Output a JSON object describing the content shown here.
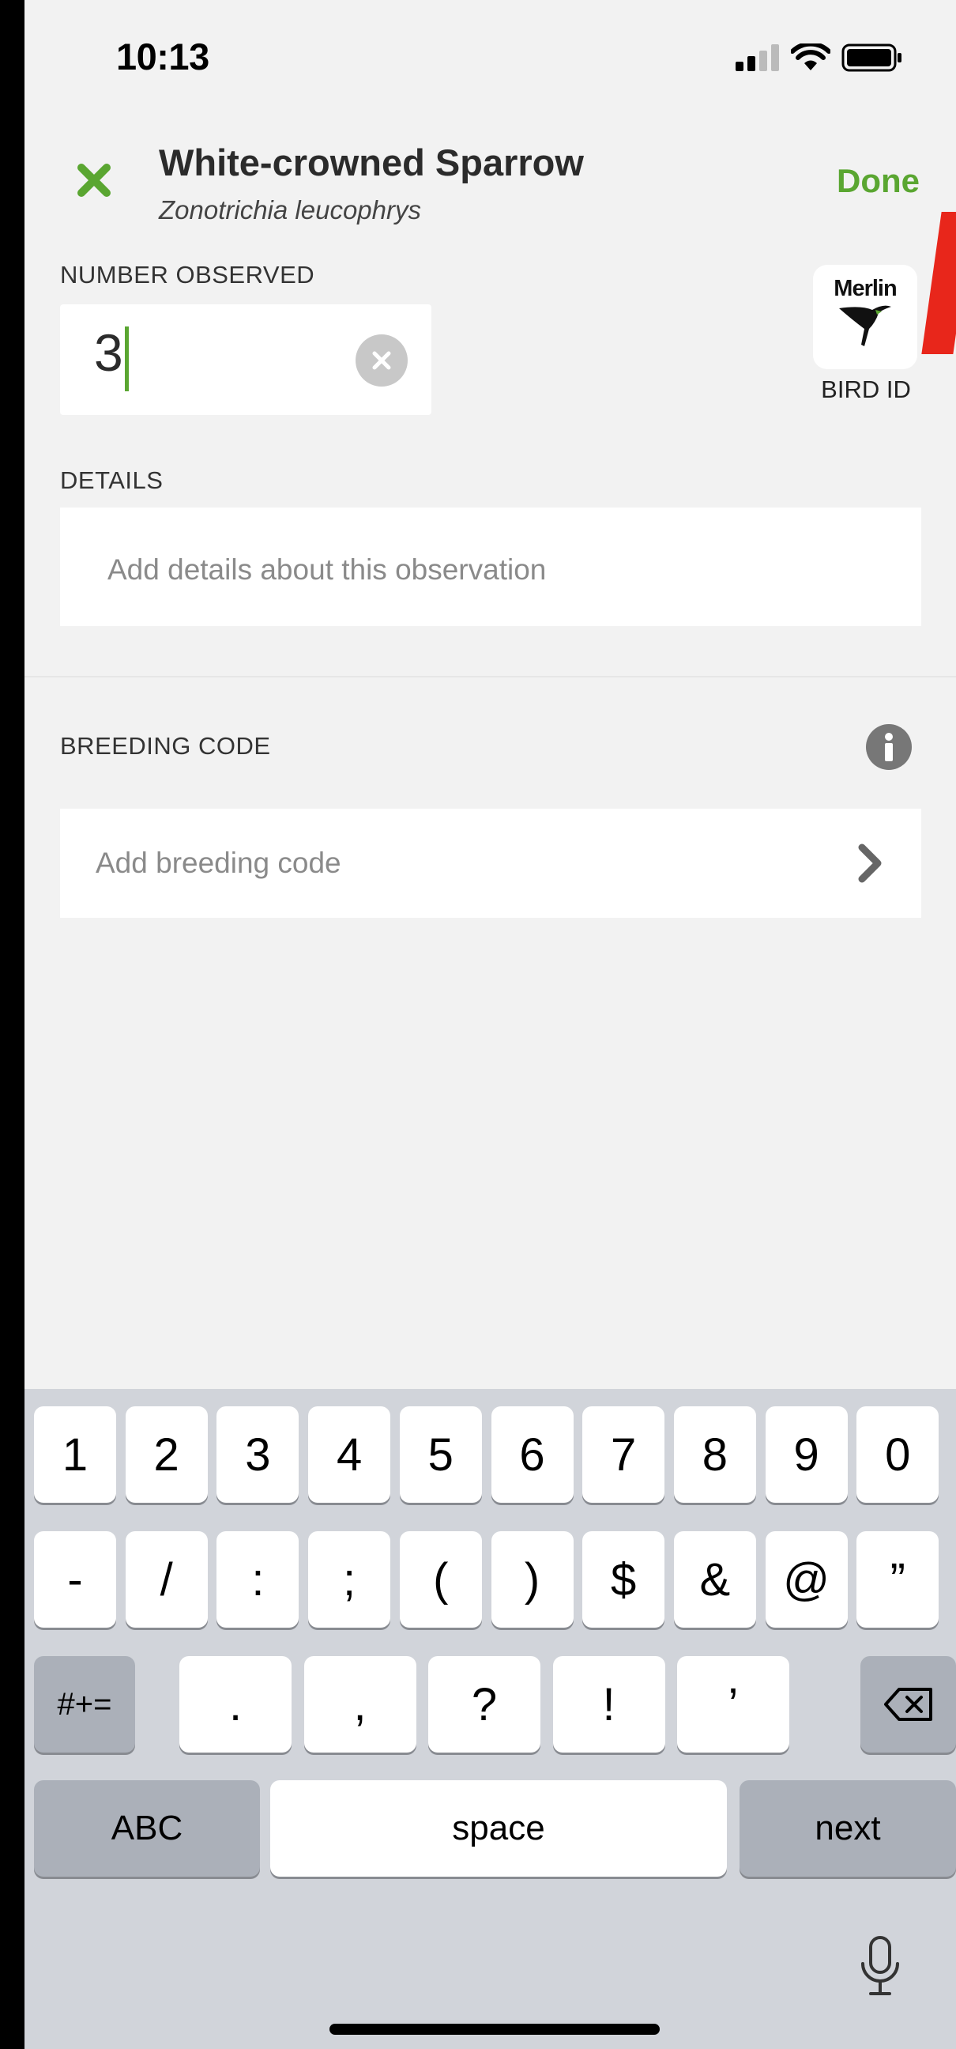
{
  "status_bar": {
    "time": "10:13"
  },
  "header": {
    "species_name": "White-crowned Sparrow",
    "scientific_name": "Zonotrichia leucophrys",
    "done_label": "Done"
  },
  "number_observed": {
    "label": "NUMBER OBSERVED",
    "value": "3"
  },
  "merlin": {
    "logo_text": "Merlin",
    "label": "BIRD ID"
  },
  "details": {
    "label": "DETAILS",
    "placeholder": "Add details about this observation"
  },
  "breeding": {
    "label": "BREEDING CODE",
    "placeholder": "Add breeding code"
  },
  "keyboard": {
    "row1": [
      "1",
      "2",
      "3",
      "4",
      "5",
      "6",
      "7",
      "8",
      "9",
      "0"
    ],
    "row2": [
      "-",
      "/",
      ":",
      ";",
      "(",
      ")",
      "$",
      "&",
      "@",
      "”"
    ],
    "row3": {
      "shift": "#+=",
      "keys": [
        ".",
        ",",
        "?",
        "!",
        "’"
      ]
    },
    "abc": "ABC",
    "space": "space",
    "next": "next"
  },
  "colors": {
    "accent": "#5aa631",
    "background": "#f2f2f2",
    "keyboard": "#d1d4da"
  }
}
